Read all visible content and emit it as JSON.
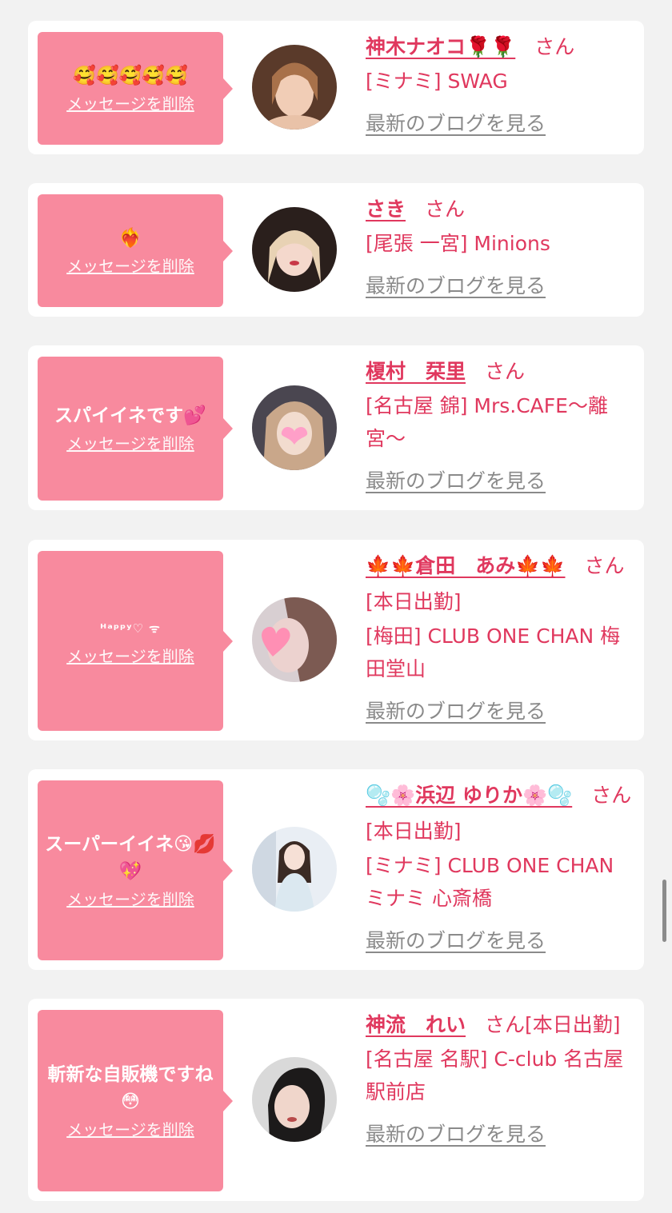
{
  "cards": [
    {
      "message": "🥰🥰🥰🥰🥰",
      "delete_label": "メッセージを削除",
      "avatar": "avatar-photo-1",
      "name": "神木ナオコ🌹🌹",
      "suffix": "さん",
      "shop": "[ミナミ] SWAG",
      "blog_link": "最新のブログを見る"
    },
    {
      "message": "❤️‍🔥",
      "delete_label": "メッセージを削除",
      "avatar": "avatar-photo-2",
      "name": "さき",
      "suffix": "さん",
      "shop": "[尾張 一宮] Minions",
      "blog_link": "最新のブログを見る"
    },
    {
      "message": "スパイイネです💕",
      "delete_label": "メッセージを削除",
      "avatar": "avatar-photo-3",
      "name": "榎村　栞里",
      "suffix": "さん",
      "shop": "[名古屋 錦] Mrs.CAFE〜離宮〜",
      "blog_link": "最新のブログを見る"
    },
    {
      "message": "ᴴᵃᵖᵖʸ♡ ᯤ",
      "delete_label": "メッセージを削除",
      "avatar": "avatar-photo-4",
      "name": "🍁🍁倉田　あみ🍁🍁",
      "suffix": "さん[本日出勤]",
      "shop": "[梅田] CLUB ONE CHAN 梅田堂山",
      "blog_link": "最新のブログを見る"
    },
    {
      "message": "スーパーイイネ😘💋💖",
      "delete_label": "メッセージを削除",
      "avatar": "avatar-photo-5",
      "name": "🫧🌸浜辺 ゆりか🌸🫧",
      "suffix": "さん[本日出勤]",
      "shop": "[ミナミ] CLUB ONE CHAN ミナミ 心斎橋",
      "blog_link": "最新のブログを見る"
    },
    {
      "message": "斬新な自販機ですね😳",
      "delete_label": "メッセージを削除",
      "avatar": "avatar-photo-6",
      "name": "神流　れい",
      "suffix": "さん[本日出勤]",
      "shop": "[名古屋 名駅] C-club 名古屋駅前店",
      "blog_link": "最新のブログを見る"
    }
  ],
  "colors": {
    "page_bg": "#f2f2f2",
    "bubble": "#f88a9e",
    "accent": "#e0385e",
    "link_gray": "#8a8a8a"
  }
}
